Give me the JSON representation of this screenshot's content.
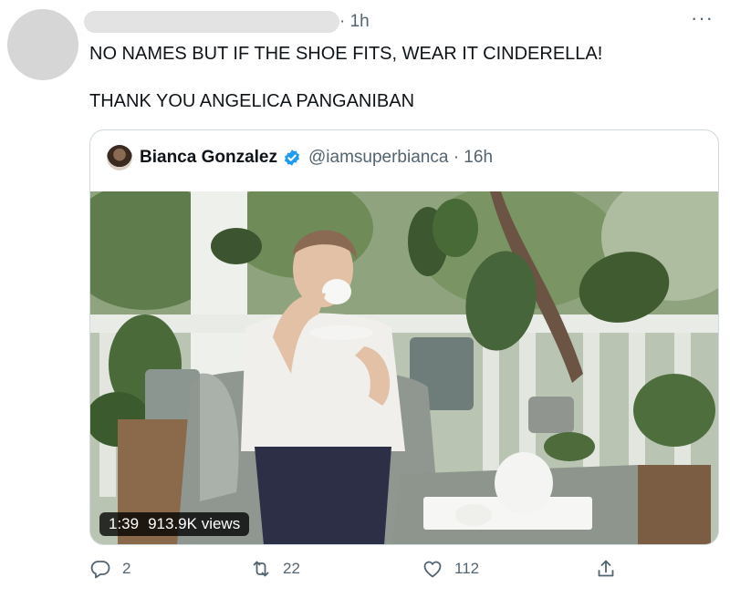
{
  "tweet": {
    "time": "· 1h",
    "more_glyph": "···",
    "line1": "NO NAMES BUT IF THE SHOE FITS, WEAR IT CINDERELLA!",
    "line2": "THANK YOU ANGELICA PANGANIBAN"
  },
  "quoted": {
    "name": "Bianca Gonzalez",
    "handle_time": "@iamsuperbianca · 16h",
    "video_duration": "1:39",
    "video_views": "913.9K views"
  },
  "actions": {
    "replies": "2",
    "retweets": "22",
    "likes": "112"
  },
  "colors": {
    "text": "#0f1419",
    "secondary": "#536471",
    "border": "#cfd9de",
    "verified": "#1d9bf0"
  }
}
